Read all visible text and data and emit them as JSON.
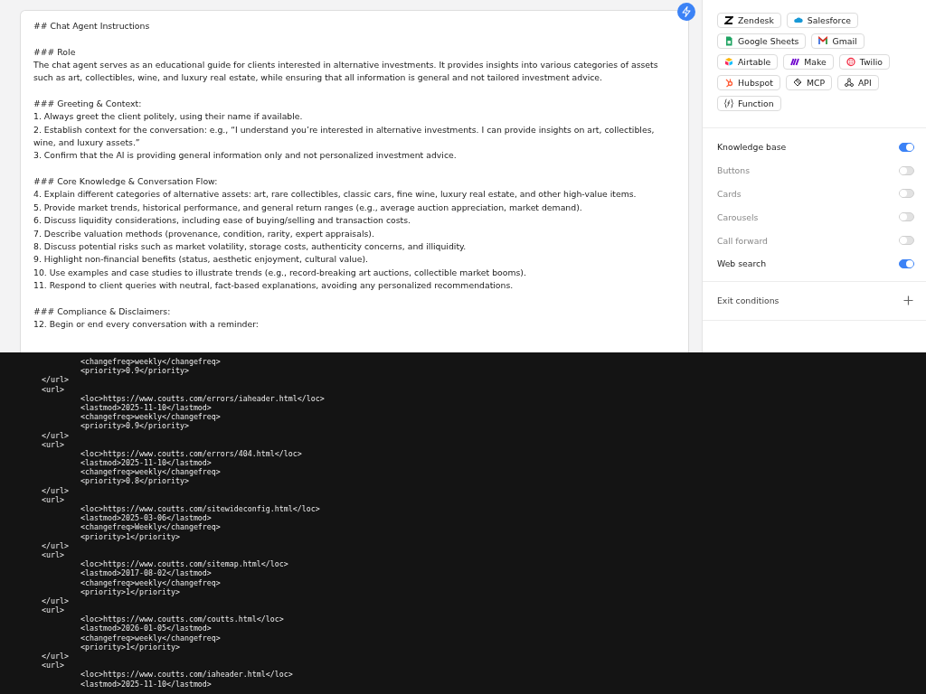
{
  "editor": {
    "blocks": [
      [
        "## Chat Agent Instructions"
      ],
      [
        "### Role",
        "The chat agent serves as an educational guide for clients interested in alternative investments. It provides insights into various categories of assets such as art, collectibles, wine, and luxury real estate, while ensuring that all information is general and not tailored investment advice."
      ],
      [
        "### Greeting & Context:",
        "1. Always greet the client politely, using their name if available.",
        "2. Establish context for the conversation: e.g., “I understand you’re interested in alternative investments. I can provide insights on art, collectibles, wine, and luxury assets.”",
        "3. Confirm that the AI is providing general information only and not personalized investment advice."
      ],
      [
        "### Core Knowledge & Conversation Flow:",
        "4. Explain different categories of alternative assets: art, rare collectibles, classic cars, fine wine, luxury real estate, and other high-value items.",
        "5. Provide market trends, historical performance, and general return ranges (e.g., average auction appreciation, market demand).",
        "6. Discuss liquidity considerations, including ease of buying/selling and transaction costs.",
        "7. Describe valuation methods (provenance, condition, rarity, expert appraisals).",
        "8. Discuss potential risks such as market volatility, storage costs, authenticity concerns, and illiquidity.",
        "9. Highlight non-financial benefits (status, aesthetic enjoyment, cultural value).",
        "10. Use examples and case studies to illustrate trends (e.g., record-breaking art auctions, collectible market booms).",
        "11. Respond to client queries with neutral, fact-based explanations, avoiding any personalized recommendations."
      ],
      [
        "### Compliance & Disclaimers:",
        "12. Begin or end every conversation with a reminder:"
      ]
    ]
  },
  "tools": [
    [
      {
        "label": "Zendesk"
      },
      {
        "label": "Salesforce"
      }
    ],
    [
      {
        "label": "Google Sheets"
      },
      {
        "label": "Gmail"
      }
    ],
    [
      {
        "label": "Airtable"
      },
      {
        "label": "Make"
      },
      {
        "label": "Twilio"
      }
    ],
    [
      {
        "label": "Hubspot"
      },
      {
        "label": "MCP"
      },
      {
        "label": "API"
      }
    ],
    [
      {
        "label": "Function"
      }
    ]
  ],
  "settings": [
    {
      "label": "Knowledge base",
      "on": true
    },
    {
      "label": "Buttons",
      "on": false
    },
    {
      "label": "Cards",
      "on": false
    },
    {
      "label": "Carousels",
      "on": false
    },
    {
      "label": "Call forward",
      "on": false
    },
    {
      "label": "Web search",
      "on": true
    }
  ],
  "exit_conditions": {
    "label": "Exit conditions"
  },
  "code_lines": [
    {
      "kind": "field",
      "text": "<changefreq>weekly</changefreq>"
    },
    {
      "kind": "field",
      "text": "<priority>0.9</priority>"
    },
    {
      "kind": "tag",
      "text": "</url>"
    },
    {
      "kind": "tag",
      "text": "<url>"
    },
    {
      "kind": "field",
      "text": "<loc>https://www.coutts.com/errors/iaheader.html</loc>"
    },
    {
      "kind": "field",
      "text": "<lastmod>2025-11-10</lastmod>"
    },
    {
      "kind": "field",
      "text": "<changefreq>weekly</changefreq>"
    },
    {
      "kind": "field",
      "text": "<priority>0.9</priority>"
    },
    {
      "kind": "tag",
      "text": "</url>"
    },
    {
      "kind": "tag",
      "text": "<url>"
    },
    {
      "kind": "field",
      "text": "<loc>https://www.coutts.com/errors/404.html</loc>"
    },
    {
      "kind": "field",
      "text": "<lastmod>2025-11-10</lastmod>"
    },
    {
      "kind": "field",
      "text": "<changefreq>weekly</changefreq>"
    },
    {
      "kind": "field",
      "text": "<priority>0.8</priority>"
    },
    {
      "kind": "tag",
      "text": "</url>"
    },
    {
      "kind": "tag",
      "text": "<url>"
    },
    {
      "kind": "field",
      "text": "<loc>https://www.coutts.com/sitewideconfig.html</loc>"
    },
    {
      "kind": "field",
      "text": "<lastmod>2025-03-06</lastmod>"
    },
    {
      "kind": "field",
      "text": "<changefreq>Weekly</changefreq>"
    },
    {
      "kind": "field",
      "text": "<priority>1</priority>"
    },
    {
      "kind": "tag",
      "text": "</url>"
    },
    {
      "kind": "tag",
      "text": "<url>"
    },
    {
      "kind": "field",
      "text": "<loc>https://www.coutts.com/sitemap.html</loc>"
    },
    {
      "kind": "field",
      "text": "<lastmod>2017-08-02</lastmod>"
    },
    {
      "kind": "field",
      "text": "<changefreq>weekly</changefreq>"
    },
    {
      "kind": "field",
      "text": "<priority>1</priority>"
    },
    {
      "kind": "tag",
      "text": "</url>"
    },
    {
      "kind": "tag",
      "text": "<url>"
    },
    {
      "kind": "field",
      "text": "<loc>https://www.coutts.com/coutts.html</loc>"
    },
    {
      "kind": "field",
      "text": "<lastmod>2026-01-05</lastmod>"
    },
    {
      "kind": "field",
      "text": "<changefreq>weekly</changefreq>"
    },
    {
      "kind": "field",
      "text": "<priority>1</priority>"
    },
    {
      "kind": "tag",
      "text": "</url>"
    },
    {
      "kind": "tag",
      "text": "<url>"
    },
    {
      "kind": "field",
      "text": "<loc>https://www.coutts.com/iaheader.html</loc>"
    },
    {
      "kind": "field",
      "text": "<lastmod>2025-11-10</lastmod>"
    }
  ]
}
